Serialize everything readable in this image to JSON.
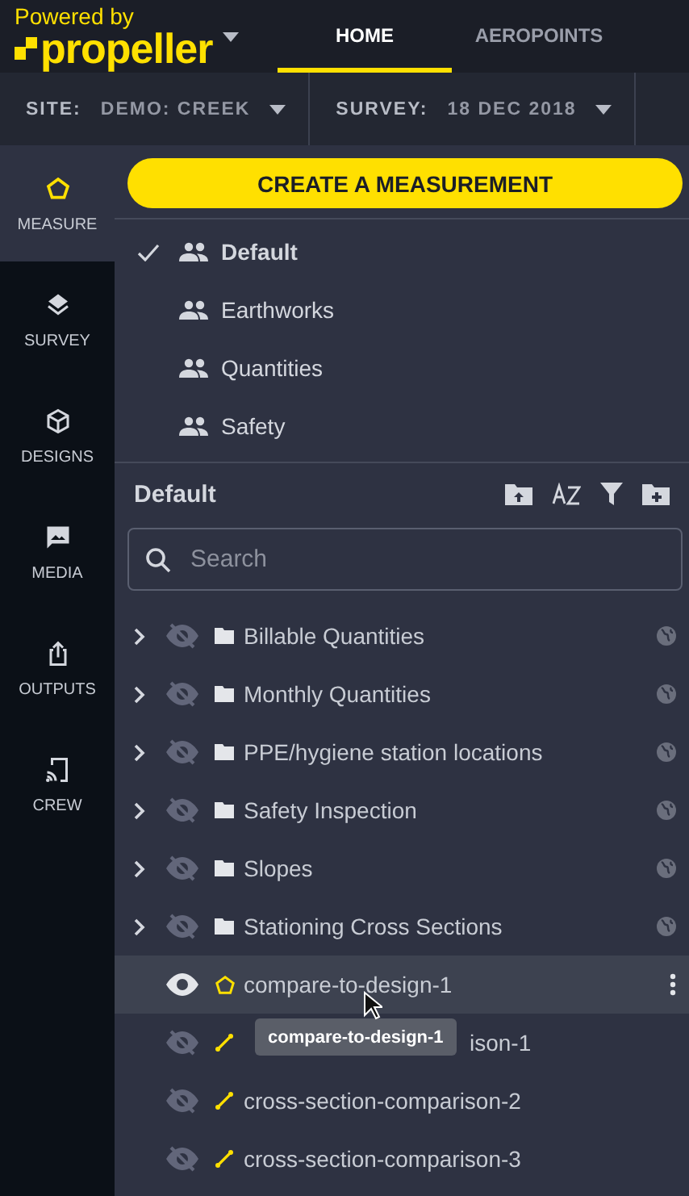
{
  "header": {
    "tagline": "Powered by",
    "brand": "propeller",
    "tabs": [
      {
        "label": "HOME",
        "selected": true
      },
      {
        "label": "AEROPOINTS",
        "selected": false
      }
    ]
  },
  "filters": [
    {
      "label": "SITE:",
      "value": "DEMO: CREEK"
    },
    {
      "label": "SURVEY:",
      "value": "18 DEC 2018"
    }
  ],
  "nav": [
    {
      "label": "MEASURE",
      "selected": true
    },
    {
      "label": "SURVEY",
      "selected": false
    },
    {
      "label": "DESIGNS",
      "selected": false
    },
    {
      "label": "MEDIA",
      "selected": false
    },
    {
      "label": "OUTPUTS",
      "selected": false
    },
    {
      "label": "CREW",
      "selected": false
    }
  ],
  "create_button": "CREATE A MEASUREMENT",
  "groups": [
    {
      "label": "Default",
      "checked": true
    },
    {
      "label": "Earthworks",
      "checked": false
    },
    {
      "label": "Quantities",
      "checked": false
    },
    {
      "label": "Safety",
      "checked": false
    }
  ],
  "panel": {
    "title": "Default",
    "search": {
      "placeholder": "Search"
    },
    "items": [
      {
        "kind": "folder",
        "label": "Billable Quantities",
        "visible": false,
        "selected": false
      },
      {
        "kind": "folder",
        "label": "Monthly Quantities",
        "visible": false,
        "selected": false
      },
      {
        "kind": "folder",
        "label": "PPE/hygiene station locations",
        "visible": false,
        "selected": false
      },
      {
        "kind": "folder",
        "label": "Safety Inspection",
        "visible": false,
        "selected": false
      },
      {
        "kind": "folder",
        "label": "Slopes",
        "visible": false,
        "selected": false
      },
      {
        "kind": "folder",
        "label": "Stationing Cross Sections",
        "visible": false,
        "selected": false
      },
      {
        "kind": "polygon",
        "label": "compare-to-design-1",
        "visible": true,
        "selected": true
      },
      {
        "kind": "polyline",
        "label": "ison-1",
        "visible": false,
        "selected": false,
        "under_tooltip": true
      },
      {
        "kind": "polyline",
        "label": "cross-section-comparison-2",
        "visible": false,
        "selected": false
      },
      {
        "kind": "polyline",
        "label": "cross-section-comparison-3",
        "visible": false,
        "selected": false
      }
    ]
  },
  "tooltip": "compare-to-design-1"
}
